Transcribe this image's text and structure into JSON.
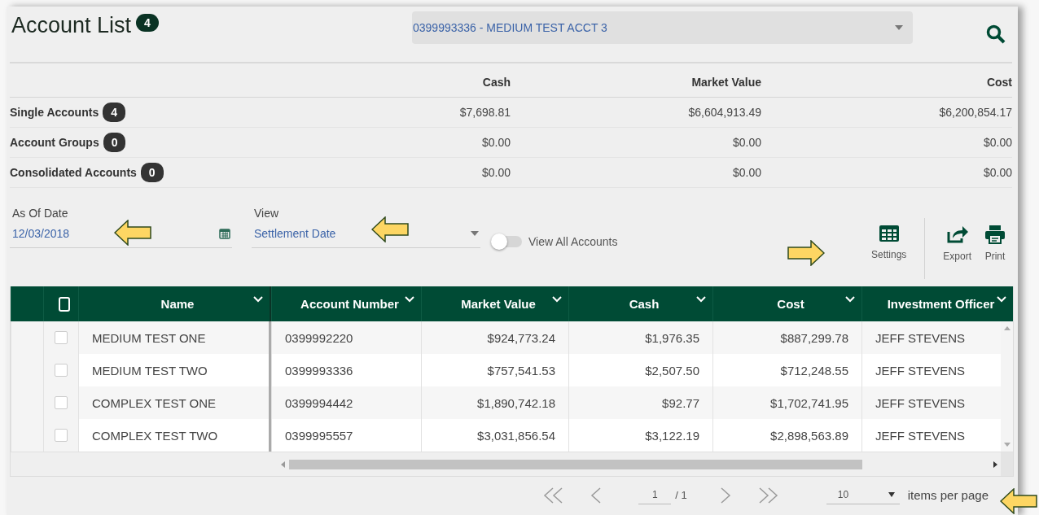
{
  "header": {
    "title": "Account List",
    "count": "4",
    "account_select": "0399993336 - MEDIUM TEST ACCT 3"
  },
  "summary": {
    "columns": [
      "Cash",
      "Market Value",
      "Cost"
    ],
    "rows": [
      {
        "label": "Single Accounts",
        "count": "4",
        "values": [
          "$7,698.81",
          "$6,604,913.49",
          "$6,200,854.17"
        ]
      },
      {
        "label": "Account Groups",
        "count": "0",
        "values": [
          "$0.00",
          "$0.00",
          "$0.00"
        ]
      },
      {
        "label": "Consolidated Accounts",
        "count": "0",
        "values": [
          "$0.00",
          "$0.00",
          "$0.00"
        ]
      }
    ]
  },
  "filters": {
    "as_of_date": {
      "label": "As Of Date",
      "value": "12/03/2018"
    },
    "view": {
      "label": "View",
      "value": "Settlement Date"
    },
    "view_all_accounts": {
      "label": "View All Accounts",
      "on": false
    }
  },
  "toolbar": [
    {
      "kind": "settings",
      "label": "Settings"
    },
    {
      "kind": "export",
      "label": "Export"
    },
    {
      "kind": "print",
      "label": "Print"
    }
  ],
  "grid": {
    "select_all_checked": false,
    "columns": [
      {
        "label": "Name",
        "kind": "text"
      },
      {
        "label": "Account Number",
        "kind": "text"
      },
      {
        "label": "Market Value",
        "kind": "money"
      },
      {
        "label": "Cash",
        "kind": "money"
      },
      {
        "label": "Cost",
        "kind": "money"
      },
      {
        "label": "Investment Officer",
        "kind": "text"
      }
    ],
    "rows": [
      {
        "checked": false,
        "cells": [
          "MEDIUM TEST ONE",
          "0399992220",
          "$924,773.24",
          "$1,976.35",
          "$887,299.78",
          "JEFF STEVENS"
        ]
      },
      {
        "checked": false,
        "cells": [
          "MEDIUM TEST TWO",
          "0399993336",
          "$757,541.53",
          "$2,507.50",
          "$712,248.55",
          "JEFF STEVENS"
        ]
      },
      {
        "checked": false,
        "cells": [
          "COMPLEX TEST ONE",
          "0399994442",
          "$1,890,742.18",
          "$92.77",
          "$1,702,741.95",
          "JEFF STEVENS"
        ]
      },
      {
        "checked": false,
        "cells": [
          "COMPLEX TEST TWO",
          "0399995557",
          "$3,031,856.54",
          "$3,122.19",
          "$2,898,563.89",
          "JEFF STEVENS"
        ]
      }
    ]
  },
  "pager": {
    "page": "1",
    "total": "/ 1",
    "page_size": "10",
    "page_size_label": "items per page"
  },
  "callouts": [
    {
      "kind": "arrow_left"
    },
    {
      "kind": "arrow_left"
    },
    {
      "kind": "arrow_right"
    },
    {
      "kind": "arrow_left"
    }
  ]
}
